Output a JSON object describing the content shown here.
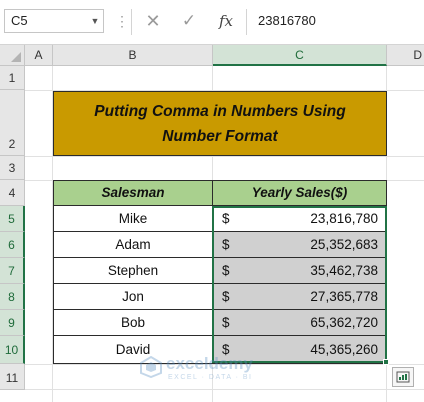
{
  "formula_bar": {
    "name_box": "C5",
    "dots": "⋮",
    "cancel_glyph": "✕",
    "enter_glyph": "✓",
    "fx_label": "fx",
    "formula": "23816780"
  },
  "columns": [
    "A",
    "B",
    "C",
    "D"
  ],
  "rows": [
    "1",
    "2",
    "3",
    "4",
    "5",
    "6",
    "7",
    "8",
    "9",
    "10",
    "11"
  ],
  "title": "Putting Comma in Numbers Using Number Format",
  "table": {
    "headers": [
      "Salesman",
      "Yearly Sales($)"
    ],
    "currency_symbol": "$",
    "rows": [
      {
        "name": "Mike",
        "sales": "23,816,780"
      },
      {
        "name": "Adam",
        "sales": "25,352,683"
      },
      {
        "name": "Stephen",
        "sales": "35,462,738"
      },
      {
        "name": "Jon",
        "sales": "27,365,778"
      },
      {
        "name": "Bob",
        "sales": "65,362,720"
      },
      {
        "name": "David",
        "sales": "45,365,260"
      }
    ]
  },
  "watermark": {
    "name": "exceldemy",
    "tagline": "EXCEL · DATA · BI"
  },
  "colors": {
    "title_fill": "#c99a00",
    "header_fill": "#a9d08e",
    "selection_fill": "#d0d0d0",
    "accent": "#217346"
  },
  "icons": {
    "cancel": "close-icon",
    "enter": "check-icon",
    "function": "fx-icon",
    "quick_analysis": "quick-analysis-icon"
  }
}
